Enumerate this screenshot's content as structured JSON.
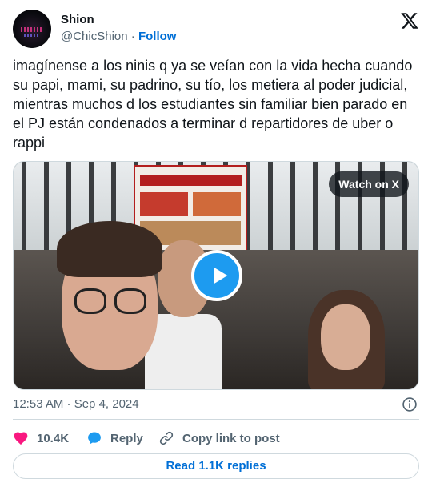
{
  "author": {
    "name": "Shion",
    "handle": "@ChicShion",
    "separator": " · ",
    "follow_label": "Follow",
    "avatar_icon": "avatar-image"
  },
  "brand": {
    "logo_icon": "x-logo-icon"
  },
  "tweet": {
    "text": "imagínense a los ninis q ya se veían con la vida hecha cuando su papi, mami, su padrino, su tío, los metiera al poder judicial, mientras muchos d los estudiantes sin familiar bien parado en el PJ están condenados a terminar d repartidores de uber o rappi"
  },
  "media": {
    "watch_label": "Watch on X",
    "play_icon": "play-icon"
  },
  "meta": {
    "timestamp": "12:53 AM · Sep 4, 2024",
    "info_icon": "info-icon"
  },
  "actions": {
    "likes_count": "10.4K",
    "reply_label": "Reply",
    "copy_label": "Copy link to post"
  },
  "footer": {
    "read_replies_label": "Read 1.1K replies"
  },
  "colors": {
    "accent_blue": "#1d9bf0",
    "link_blue": "#006fd6",
    "like_pink": "#f91880",
    "muted_text": "#536471",
    "border": "#cfd9de"
  }
}
